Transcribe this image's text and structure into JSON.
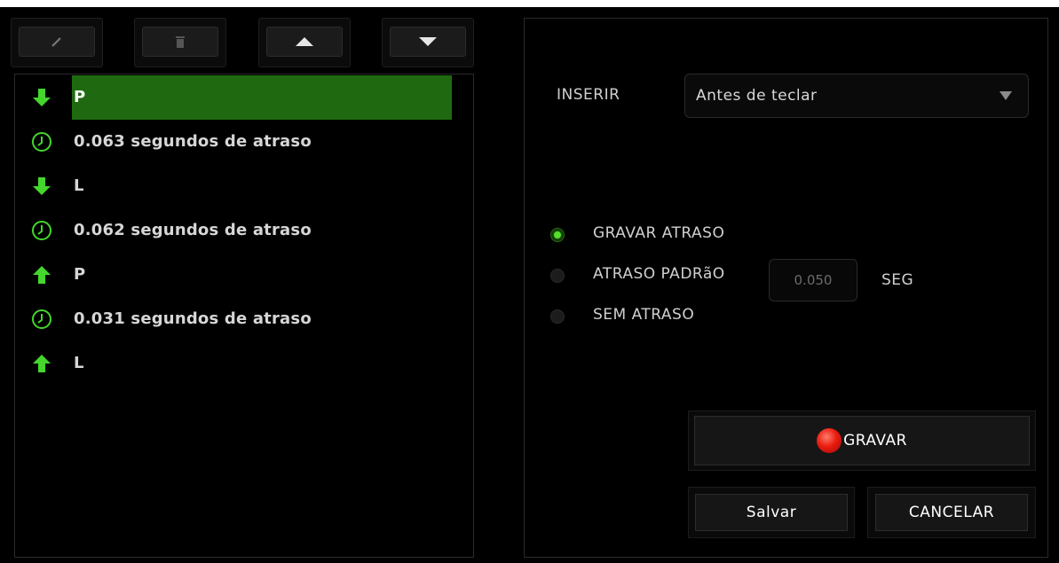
{
  "toolbar": {
    "buttons": [
      {
        "icon": "edit-icon"
      },
      {
        "icon": "trash-icon"
      },
      {
        "icon": "arrow-up-icon"
      },
      {
        "icon": "arrow-down-icon"
      }
    ]
  },
  "macro_list": {
    "items": [
      {
        "type": "key-down",
        "icon": "arrow-down-icon",
        "text": "P",
        "selected": true
      },
      {
        "type": "delay",
        "icon": "clock-icon",
        "text": "0.063 segundos de atraso",
        "selected": false
      },
      {
        "type": "key-down",
        "icon": "arrow-down-icon",
        "text": "L",
        "selected": false
      },
      {
        "type": "delay",
        "icon": "clock-icon",
        "text": "0.062 segundos de atraso",
        "selected": false
      },
      {
        "type": "key-up",
        "icon": "arrow-up-icon",
        "text": "P",
        "selected": false
      },
      {
        "type": "delay",
        "icon": "clock-icon",
        "text": "0.031 segundos de atraso",
        "selected": false
      },
      {
        "type": "key-up",
        "icon": "arrow-up-icon",
        "text": "L",
        "selected": false
      }
    ]
  },
  "insert": {
    "label": "INSERIR",
    "selected": "Antes de teclar"
  },
  "delay_options": {
    "record_delay": {
      "label": "GRAVAR ATRASO",
      "checked": true
    },
    "default_delay": {
      "label": "ATRASO PADRãO",
      "checked": false,
      "value": "0.050",
      "unit": "SEG"
    },
    "no_delay": {
      "label": "SEM ATRASO",
      "checked": false
    }
  },
  "buttons": {
    "record": "GRAVAR",
    "save": "Salvar",
    "cancel": "CANCELAR"
  },
  "colors": {
    "accent_green": "#44d62c",
    "selected_row": "#1f6a10",
    "record_red": "#ea1c10"
  }
}
